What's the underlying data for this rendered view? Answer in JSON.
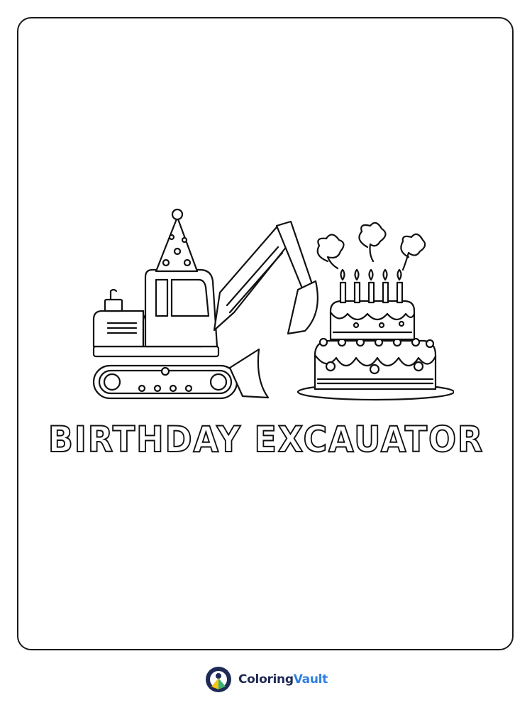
{
  "page": {
    "title": "BIRTHDAY EXCAUATOR"
  },
  "footer": {
    "brand_part1": "Coloring",
    "brand_part2": "Vault",
    "logo_icon": "coloringvault-logo-icon"
  },
  "colors": {
    "outline": "#111111",
    "brand_dark": "#1f2a55",
    "brand_blue": "#2f7fe0",
    "brand_yellow": "#f5c518",
    "brand_green": "#3bb273"
  }
}
